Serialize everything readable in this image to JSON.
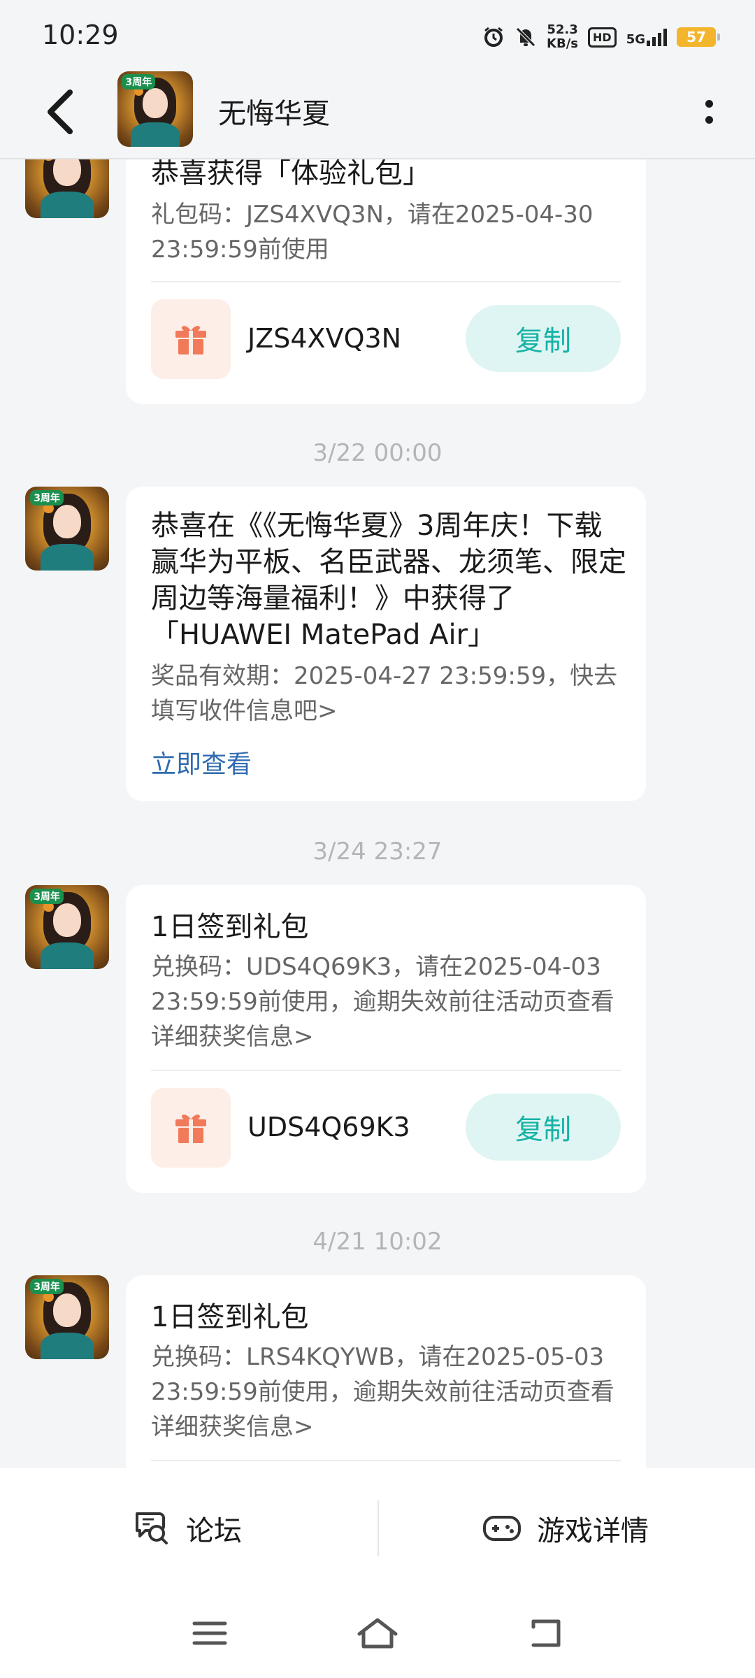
{
  "status_bar": {
    "time": "10:29",
    "net_speed_value": "52.3",
    "net_speed_unit": "KB/s",
    "hd_badge": "HD",
    "network": "5G",
    "battery": "57",
    "icons": [
      "alarm-icon",
      "mute-icon",
      "signal-icon",
      "battery-icon"
    ]
  },
  "header": {
    "title": "无悔华夏",
    "avatar_tag": "3周年"
  },
  "messages": [
    {
      "title": "恭喜获得「体验礼包」",
      "body": "礼包码：JZS4XVQ3N，请在2025-04-30 23:59:59前使用",
      "code": "JZS4XVQ3N",
      "copy_label": "复制"
    },
    {
      "timestamp": "3/22  00:00",
      "title": "恭喜在《《无悔华夏》3周年庆！下载赢华为平板、名臣武器、龙须笔、限定周边等海量福利！》中获得了「HUAWEI MatePad Air」",
      "body": "奖品有效期：2025-04-27 23:59:59，快去填写收件信息吧>",
      "link": "立即查看"
    },
    {
      "timestamp": "3/24  23:27",
      "title": "1日签到礼包",
      "body": "兑换码：UDS4Q69K3，请在2025-04-03 23:59:59前使用，逾期失效前往活动页查看详细获奖信息>",
      "code": "UDS4Q69K3",
      "copy_label": "复制"
    },
    {
      "timestamp": "4/21  10:02",
      "title": "1日签到礼包",
      "body": "兑换码：LRS4KQYWB，请在2025-05-03 23:59:59前使用，逾期失效前往活动页查看详细获奖信息>"
    }
  ],
  "bottom_bar": {
    "forum_label": "论坛",
    "game_detail_label": "游戏详情"
  },
  "colors": {
    "accent": "#17b3a6",
    "link": "#2f6bb0",
    "gift_bg": "#fdeee8",
    "gift_icon": "#f07a5a"
  }
}
